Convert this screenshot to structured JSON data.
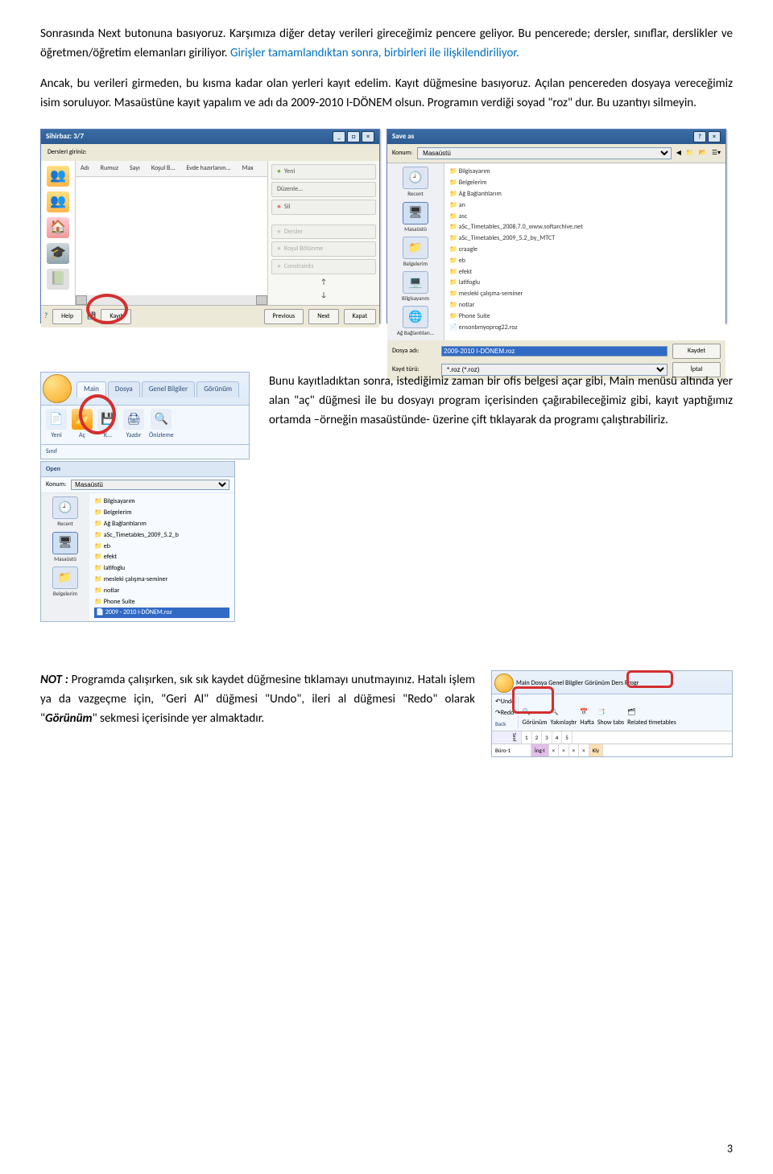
{
  "para1_a": "Sonrasında Next butonuna basıyoruz. Karşımıza diğer detay verileri gireceğimiz pencere geliyor. Bu pencerede; dersler, sınıflar, derslikler ve öğretmen/öğretim elemanları giriliyor. ",
  "para1_b": "Girişler tamamlandıktan sonra, birbirleri ile ilişkilendiriliyor.",
  "para2": "Ancak, bu verileri girmeden, bu kısma kadar olan yerleri kayıt edelim. Kayıt düğmesine basıyoruz. Açılan pencereden dosyaya vereceğimiz isim soruluyor. Masaüstüne kayıt yapalım ve adı da 2009-2010 I-DÖNEM olsun. Programın verdiği soyad \"roz\" dur. Bu uzantıyı silmeyin.",
  "wizard": {
    "title": "Sihirbaz: 3/7",
    "header": "Dersleri giriniz:",
    "cols": [
      "Adı",
      "Rumuz",
      "Sayı",
      "Koşul B...",
      "Evde hazırlanın...",
      "Max"
    ],
    "tools": {
      "yeni": "Yeni",
      "duzenle": "Düzenle...",
      "sil": "Sil",
      "dersler": "Dersler",
      "kosul": "Koşul Bölünme",
      "constraints": "Constraints"
    },
    "footer": {
      "help": "Help",
      "kayit": "Kayıt",
      "prev": "Previous",
      "next": "Next",
      "kapat": "Kapat"
    }
  },
  "saveas": {
    "title": "Save as",
    "konum_label": "Konum:",
    "konum_value": "Masaüstü",
    "places": [
      "Recent",
      "Masaüstü",
      "Belgelerim",
      "Bilgisayarım",
      "Ağ Bağlantıları..."
    ],
    "files": [
      {
        "t": "folder",
        "n": "Bilgisayarım"
      },
      {
        "t": "folder",
        "n": "Belgelerim"
      },
      {
        "t": "folder",
        "n": "Ağ Bağlantılarım"
      },
      {
        "t": "folder",
        "n": "an"
      },
      {
        "t": "folder",
        "n": "asc"
      },
      {
        "t": "folder",
        "n": "aSc_Timetables_2008.7.0_www.softarchive.net"
      },
      {
        "t": "folder",
        "n": "aSc_Timetables_2009_5.2_by_MTCT"
      },
      {
        "t": "folder",
        "n": "craagle"
      },
      {
        "t": "folder",
        "n": "eb"
      },
      {
        "t": "folder",
        "n": "efekt"
      },
      {
        "t": "folder",
        "n": "latifoglu"
      },
      {
        "t": "folder",
        "n": "mesleki çalışma-seminer"
      },
      {
        "t": "folder",
        "n": "notlar"
      },
      {
        "t": "folder",
        "n": "Phone Suite"
      },
      {
        "t": "file",
        "n": "ensonbmyoprog22.roz"
      }
    ],
    "filename_label": "Dosya adı:",
    "filename_value": "2009-2010 I-DÖNEM.roz",
    "type_label": "Kayıt türü:",
    "type_value": "*.roz (*.roz)",
    "save_btn": "Kaydet",
    "cancel_btn": "İptal"
  },
  "ribbon1": {
    "tabs": [
      "Main",
      "Dosya",
      "Genel Bilgiler",
      "Görünüm"
    ],
    "items": [
      {
        "label": "Yeni",
        "icon": "📄"
      },
      {
        "label": "Aç",
        "icon": "📂"
      },
      {
        "label": "K...",
        "icon": "💾"
      },
      {
        "label": "Yazdır",
        "icon": "🖨"
      },
      {
        "label": "Önizleme",
        "icon": "🔍"
      }
    ],
    "sinif": "Sınıf"
  },
  "open_panel": {
    "header": "Open",
    "konum_label": "Konum:",
    "konum_value": "Masaüstü",
    "places": [
      "Recent",
      "Masaüstü",
      "Belgelerim"
    ],
    "items": [
      {
        "t": "folder",
        "n": "Bilgisayarım"
      },
      {
        "t": "folder",
        "n": "Belgelerim"
      },
      {
        "t": "folder",
        "n": "Ağ Bağlantılarım"
      },
      {
        "t": "folder",
        "n": "aSc_Timetables_2009_5.2_b"
      },
      {
        "t": "folder",
        "n": "eb"
      },
      {
        "t": "folder",
        "n": "efekt"
      },
      {
        "t": "folder",
        "n": "latifoglu"
      },
      {
        "t": "folder",
        "n": "mesleki çalışma-seminer"
      },
      {
        "t": "folder",
        "n": "notlar"
      },
      {
        "t": "folder",
        "n": "Phone Suite"
      },
      {
        "t": "sel",
        "n": "2009 - 2010 I-DÖNEM.roz"
      }
    ]
  },
  "para3": "Bunu kayıtladıktan sonra, istediğimiz zaman bir ofis belgesi açar gibi, Main menüsü altında yer alan \"aç\" düğmesi ile bu dosyayı program içerisinden çağırabileceğimiz gibi, kayıt yaptığımız ortamda –örneğin masaüstünde- üzerine çift tıklayarak da programı çalıştırabiliriz.",
  "note_label": "NOT :",
  "note_body_a": " Programda çalışırken, sık sık kaydet düğmesine tıklamayı unutmayınız. Hatalı işlem ya da vazgeçme için, \"Geri Al\" düğmesi \"Undo\", ileri al düğmesi \"Redo\" olarak \"",
  "note_body_gorunum": "Görünüm",
  "note_body_b": "\" sekmesi içerisinde yer almaktadır.",
  "ribbon2": {
    "tabs": [
      "Main",
      "Dosya",
      "Genel Bilgiler",
      "Görünüm",
      "Ders Progr"
    ],
    "undo": "Undo",
    "redo": "Redo",
    "back": "Back",
    "items": [
      {
        "label": "Görünüm",
        "icon": "🔍"
      },
      {
        "label": "Yakınlaştır",
        "icon": "🔍"
      },
      {
        "label": "Hafta",
        "icon": "📅"
      },
      {
        "label": "Show tabs",
        "icon": "📑"
      },
      {
        "label": "Related timetables",
        "icon": "🗂"
      }
    ],
    "sinif": "Sınıf",
    "row_label": "Büro-1",
    "row_cells": [
      "1",
      "2",
      "3",
      "4",
      "5"
    ],
    "row_ing": "İng-I",
    "row_kly": "Kly"
  },
  "page_number": "3"
}
